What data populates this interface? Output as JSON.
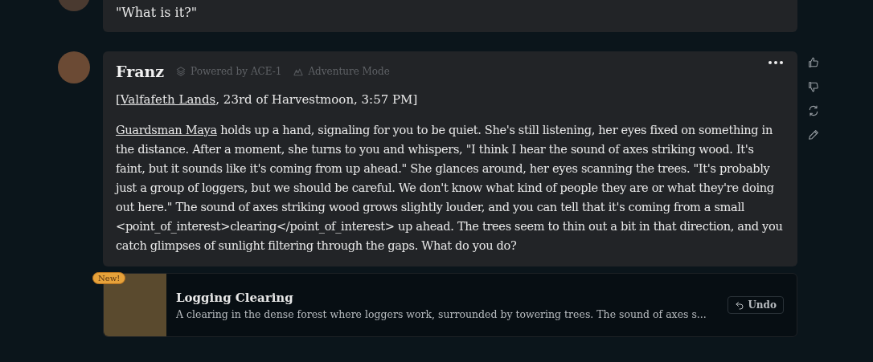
{
  "messages": [
    {
      "text": "\"What is it?\""
    },
    {
      "author": "Franz",
      "tags": [
        {
          "kind": "model",
          "label": "Powered by ACE-1"
        },
        {
          "kind": "mode",
          "label": "Adventure Mode"
        }
      ],
      "header": {
        "before": "[",
        "link": "Valfafeth Lands",
        "after": ", 23rd of Harvestmoon, 3:57 PM]"
      },
      "body": {
        "link": "Guardsman Maya",
        "text": " holds up a hand, signaling for you to be quiet. She's still listening, her eyes fixed on something in the distance. After a moment, she turns to you and whispers, \"I think I hear the sound of axes striking wood. It's faint, but it sounds like it's coming from up ahead.\" She glances around, her eyes scanning the trees. \"It's probably just a group of loggers, but we should be careful. We don't know what kind of people they are or what they're doing out here.\" The sound of axes striking wood grows slightly louder, and you can tell that it's coming from a small <point_of_interest>clearing</point_of_interest> up ahead. The trees seem to thin out a bit in that direction, and you catch glimpses of sunlight filtering through the gaps. What do you do?"
      },
      "location": {
        "badge": "New!",
        "title": "Logging Clearing",
        "description": "A clearing in the dense forest where loggers work, surrounded by towering trees. The sound of axes s...",
        "action": "Undo"
      }
    }
  ]
}
